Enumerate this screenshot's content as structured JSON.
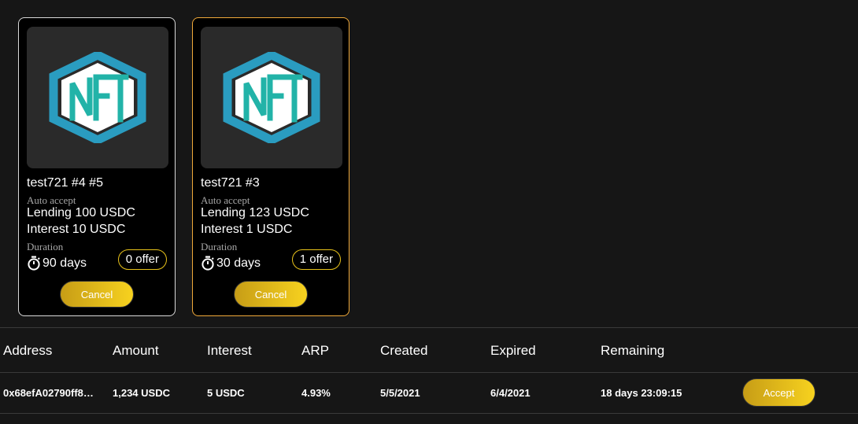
{
  "cards": [
    {
      "title": "test721 #4 #5",
      "mode": "Auto accept",
      "lending": "Lending 100 USDC",
      "interest": "Interest 10 USDC",
      "duration_label": "Duration",
      "duration": "90 days",
      "offers": "0 offer",
      "button": "Cancel",
      "image": "nft-logo-icon"
    },
    {
      "title": "test721 #3",
      "mode": "Auto accept",
      "lending": "Lending 123 USDC",
      "interest": "Interest 1 USDC",
      "duration_label": "Duration",
      "duration": "30 days",
      "offers": "1 offer",
      "button": "Cancel",
      "image": "nft-logo-icon",
      "selected": true
    }
  ],
  "table": {
    "headers": [
      "Address",
      "Amount",
      "Interest",
      "ARP",
      "Created",
      "Expired",
      "Remaining"
    ],
    "rows": [
      {
        "address": "0x68efA02790ff8…",
        "amount": "1,234 USDC",
        "interest": "5 USDC",
        "arp": "4.93%",
        "created": "5/5/2021",
        "expired": "6/4/2021",
        "remaining": "18 days 23:09:15",
        "action": "Accept"
      }
    ]
  },
  "colors": {
    "accent_gold": "#e8c21a",
    "selected_border": "#f0a93a",
    "nft_hex": "#2a9cc0",
    "nft_letters": "#22b3a8"
  }
}
